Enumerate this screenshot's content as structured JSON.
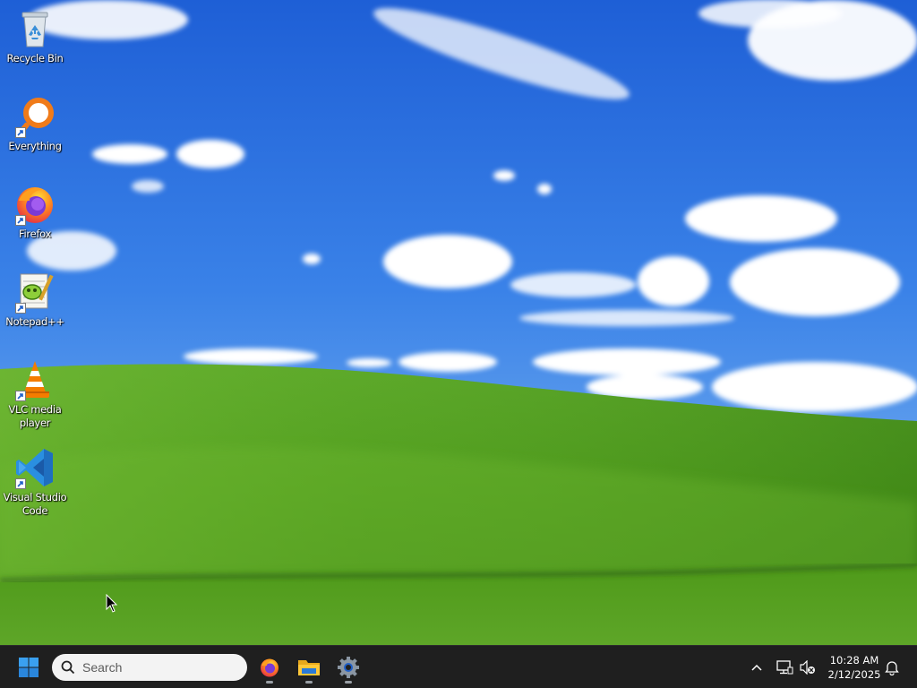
{
  "desktop": {
    "icons": [
      {
        "label": "Recycle Bin",
        "icon": "recycle-bin-icon",
        "shortcut": false
      },
      {
        "label": "Everything",
        "icon": "everything-search-icon",
        "shortcut": true
      },
      {
        "label": "Firefox",
        "icon": "firefox-icon",
        "shortcut": true
      },
      {
        "label": "Notepad++",
        "icon": "notepad-plus-plus-icon",
        "shortcut": true
      },
      {
        "label": "VLC media player",
        "icon": "vlc-cone-icon",
        "shortcut": true
      },
      {
        "label": "Visual Studio Code",
        "icon": "vscode-icon",
        "shortcut": true
      }
    ]
  },
  "taskbar": {
    "start_icon": "windows-start-icon",
    "search": {
      "placeholder": "Search",
      "icon": "search-icon"
    },
    "pinned": [
      {
        "name": "Firefox",
        "icon": "firefox-icon",
        "running": true
      },
      {
        "name": "File Explorer",
        "icon": "folder-icon",
        "running": true
      },
      {
        "name": "Settings",
        "icon": "gear-icon",
        "running": true
      }
    ],
    "tray": {
      "chevron_icon": "chevron-up-icon",
      "network_icon": "network-icon",
      "volume_icon": "volume-muted-icon",
      "time": "10:28 AM",
      "date": "2/12/2025",
      "notification_icon": "bell-icon"
    }
  },
  "colors": {
    "sky": "#2a6ee0",
    "grass": "#4f9a1c",
    "taskbar": "#1f1f1f",
    "start_blue": "#2f8fe6"
  }
}
